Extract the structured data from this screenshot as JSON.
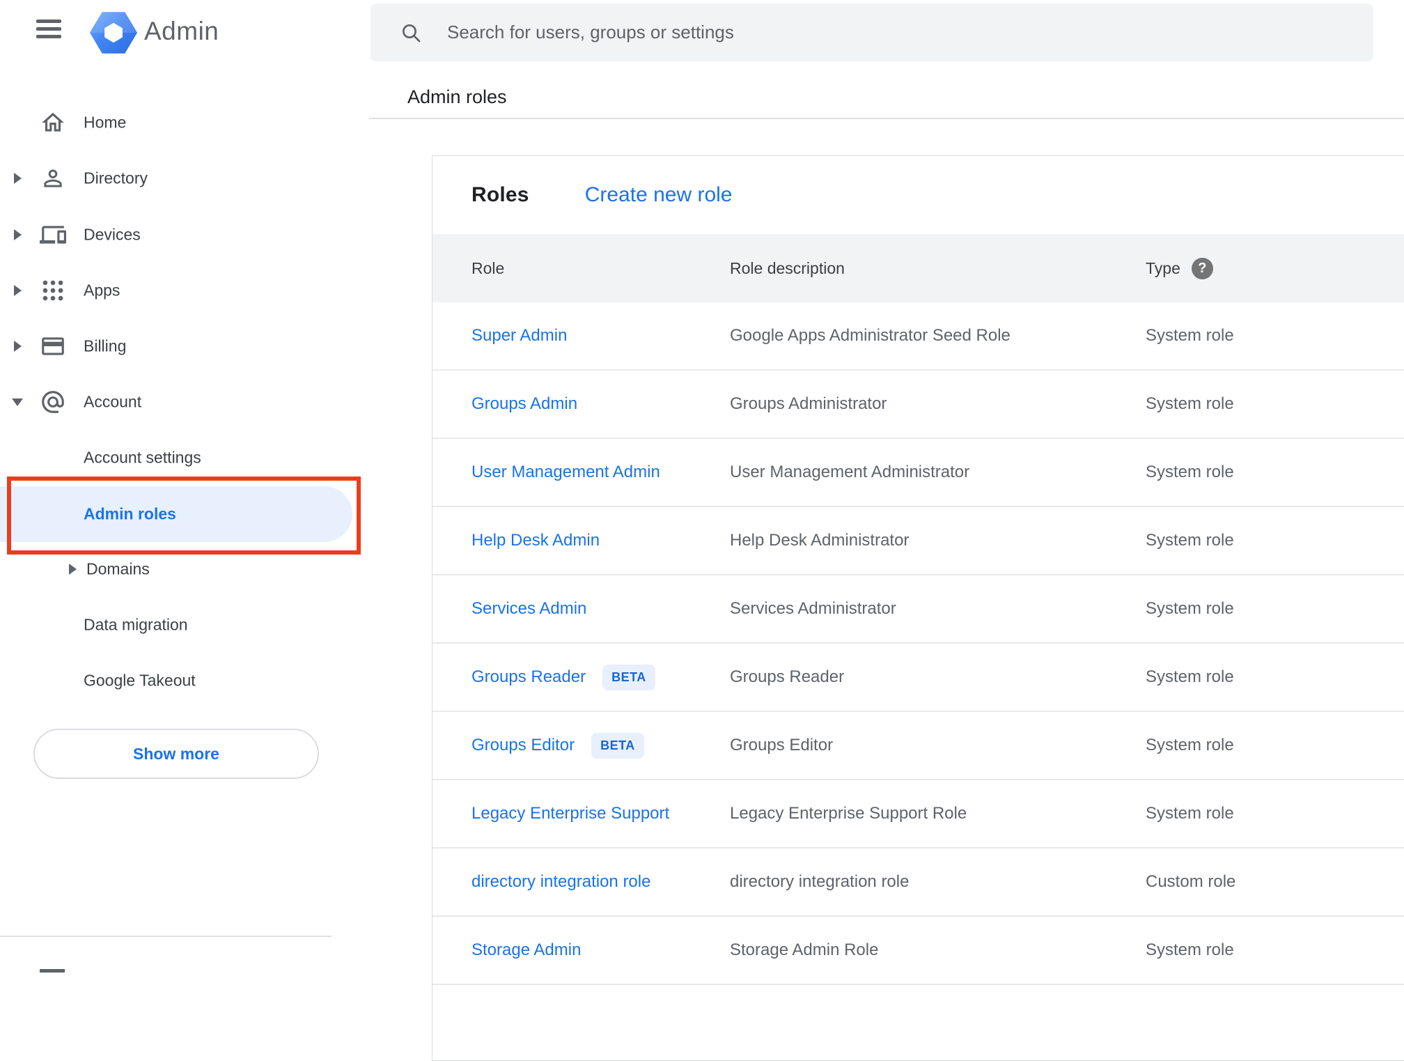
{
  "app": {
    "name": "Admin"
  },
  "search": {
    "placeholder": "Search for users, groups or settings"
  },
  "breadcrumb": {
    "title": "Admin roles"
  },
  "sidebar": {
    "items": [
      {
        "label": "Home",
        "icon": "home-icon",
        "expandable": false
      },
      {
        "label": "Directory",
        "icon": "person-icon",
        "expandable": true
      },
      {
        "label": "Devices",
        "icon": "devices-icon",
        "expandable": true
      },
      {
        "label": "Apps",
        "icon": "apps-grid-icon",
        "expandable": true
      },
      {
        "label": "Billing",
        "icon": "credit-card-icon",
        "expandable": true
      },
      {
        "label": "Account",
        "icon": "at-sign-icon",
        "expandable": true,
        "expanded": true
      }
    ],
    "subitems": [
      {
        "label": "Account settings",
        "selected": false
      },
      {
        "label": "Admin roles",
        "selected": true
      },
      {
        "label": "Domains",
        "selected": false,
        "expandable": true
      },
      {
        "label": "Data migration",
        "selected": false
      },
      {
        "label": "Google Takeout",
        "selected": false
      }
    ],
    "show_more_label": "Show more"
  },
  "panel": {
    "title": "Roles",
    "create_link": "Create new role",
    "columns": [
      "Role",
      "Role description",
      "Type"
    ],
    "help_icon_glyph": "?",
    "rows": [
      {
        "role": "Super Admin",
        "badge": null,
        "description": "Google Apps Administrator Seed Role",
        "type": "System role"
      },
      {
        "role": "Groups Admin",
        "badge": null,
        "description": "Groups Administrator",
        "type": "System role"
      },
      {
        "role": "User Management Admin",
        "badge": null,
        "description": "User Management Administrator",
        "type": "System role"
      },
      {
        "role": "Help Desk Admin",
        "badge": null,
        "description": "Help Desk Administrator",
        "type": "System role"
      },
      {
        "role": "Services Admin",
        "badge": null,
        "description": "Services Administrator",
        "type": "System role"
      },
      {
        "role": "Groups Reader",
        "badge": "BETA",
        "description": "Groups Reader",
        "type": "System role"
      },
      {
        "role": "Groups Editor",
        "badge": "BETA",
        "description": "Groups Editor",
        "type": "System role"
      },
      {
        "role": "Legacy Enterprise Support",
        "badge": null,
        "description": "Legacy Enterprise Support Role",
        "type": "System role"
      },
      {
        "role": "directory integration role",
        "badge": null,
        "description": "directory integration role",
        "type": "Custom role"
      },
      {
        "role": "Storage Admin",
        "badge": null,
        "description": "Storage Admin Role",
        "type": "System role"
      }
    ]
  },
  "colors": {
    "accent_blue": "#1a73e8",
    "selected_pill_bg": "#e8f0fe",
    "annotation_red": "#ea3e1c",
    "beta_badge_bg": "#e8f0fe",
    "beta_badge_text": "#1967d2",
    "icon_gray": "#5f6368",
    "text_dark": "#202124",
    "table_header_bg": "#f1f3f4"
  }
}
